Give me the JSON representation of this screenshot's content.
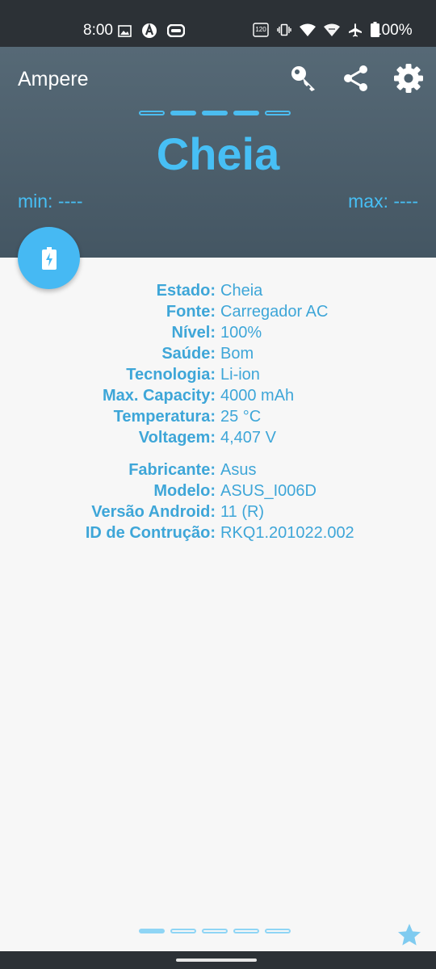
{
  "status_bar": {
    "time": "8:00",
    "left_icons": [
      "gallery-icon",
      "a-icon",
      "game-icon"
    ],
    "right_icons": [
      "refresh-rate-icon",
      "vibrate-icon",
      "wifi-icon",
      "signal-icon",
      "airplane-icon",
      "battery-icon"
    ],
    "refresh_rate_label": "120",
    "battery_pct": "100%"
  },
  "app_bar": {
    "title": "Ampere",
    "actions": [
      {
        "name": "key-icon"
      },
      {
        "name": "share-icon"
      },
      {
        "name": "settings-icon"
      }
    ]
  },
  "header": {
    "status_text": "Cheia",
    "min_label": "min: ----",
    "max_label": "max: ----",
    "level_segments_total": 5,
    "level_segments_filled": 3
  },
  "fab": {
    "icon": "battery-charging-icon"
  },
  "info": {
    "group1": [
      {
        "key": "Estado:",
        "value": "Cheia"
      },
      {
        "key": "Fonte:",
        "value": "Carregador AC"
      },
      {
        "key": "Nível:",
        "value": "100%"
      },
      {
        "key": "Saúde:",
        "value": "Bom"
      },
      {
        "key": "Tecnologia:",
        "value": "Li-ion"
      },
      {
        "key": "Max. Capacity:",
        "value": "4000 mAh"
      },
      {
        "key": "Temperatura:",
        "value": "25 °C"
      },
      {
        "key": "Voltagem:",
        "value": "4,407 V"
      }
    ],
    "group2": [
      {
        "key": "Fabricante:",
        "value": "Asus"
      },
      {
        "key": "Modelo:",
        "value": "ASUS_I006D"
      },
      {
        "key": "Versão Android:",
        "value": "11 (R)"
      },
      {
        "key": "ID de Contrução:",
        "value": "RKQ1.201022.002"
      }
    ]
  },
  "pager": {
    "pages_total": 5,
    "current_page": 1
  },
  "colors": {
    "accent": "#47bff5",
    "header_top": "#566976",
    "header_bottom": "#445663",
    "status_bar": "#2c3136",
    "info_text": "#3ea6d8",
    "background": "#f7f7f7"
  }
}
